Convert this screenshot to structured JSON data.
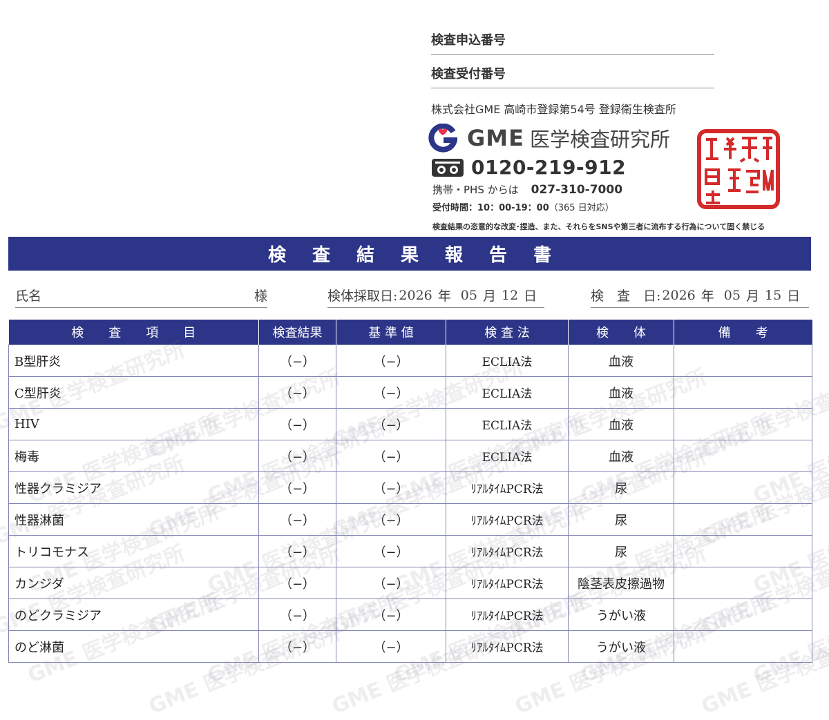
{
  "header": {
    "application_number_label": "検査申込番号",
    "reception_number_label": "検査受付番号",
    "company_registration": "株式会社GME 高崎市登録第54号 登録衛生検査所",
    "logo_text": "GME",
    "lab_name": "医学検査研究所",
    "free_dial": "0120-219-912",
    "mobile_label": "携帯・PHS からは",
    "mobile_number": "027-310-7000",
    "hours_label": "受付時間：10：00-19：00",
    "hours_note": "（365 日対応）",
    "warning": "検査結果の恣意的な改変･捏造、また、それらをSNSや第三者に流布する行為について固く禁じる",
    "seal_text": "株式会社GME印",
    "accent_color": "#2d3588",
    "seal_color": "#d42a2a"
  },
  "title": "検査結果報告書",
  "patient": {
    "name_label": "氏名",
    "honorific": "様"
  },
  "dates": {
    "collection_label": "検体採取日:",
    "collection_year": "2026",
    "collection_month": "05",
    "collection_day": "12",
    "exam_label": "検　査　日:",
    "exam_year": "2026",
    "exam_month": "05",
    "exam_day": "15",
    "year_unit": "年",
    "month_unit": "月",
    "day_unit": "日"
  },
  "table": {
    "headers": [
      "検　　査　　項　　目",
      "検査結果",
      "基 準 値",
      "検 査 法",
      "検　　体",
      "備　　考"
    ],
    "rows": [
      [
        "B型肝炎",
        "（−）",
        "（−）",
        "ECLIA法",
        "血液",
        ""
      ],
      [
        "C型肝炎",
        "（−）",
        "（−）",
        "ECLIA法",
        "血液",
        ""
      ],
      [
        "HIV",
        "（−）",
        "（−）",
        "ECLIA法",
        "血液",
        ""
      ],
      [
        "梅毒",
        "（−）",
        "（−）",
        "ECLIA法",
        "血液",
        ""
      ],
      [
        "性器クラミジア",
        "（−）",
        "（−）",
        "ﾘｱﾙﾀｲﾑPCR法",
        "尿",
        ""
      ],
      [
        "性器淋菌",
        "（−）",
        "（−）",
        "ﾘｱﾙﾀｲﾑPCR法",
        "尿",
        ""
      ],
      [
        "トリコモナス",
        "（−）",
        "（−）",
        "ﾘｱﾙﾀｲﾑPCR法",
        "尿",
        ""
      ],
      [
        "カンジダ",
        "（−）",
        "（−）",
        "ﾘｱﾙﾀｲﾑPCR法",
        "陰茎表皮擦過物",
        ""
      ],
      [
        "のどクラミジア",
        "（−）",
        "（−）",
        "ﾘｱﾙﾀｲﾑPCR法",
        "うがい液",
        ""
      ],
      [
        "のど淋菌",
        "（−）",
        "（−）",
        "ﾘｱﾙﾀｲﾑPCR法",
        "うがい液",
        ""
      ]
    ]
  },
  "watermark": "GME 医学検査研究所"
}
